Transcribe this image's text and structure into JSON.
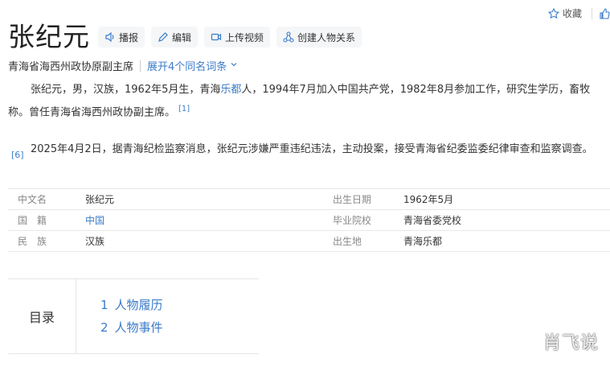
{
  "top_actions": {
    "favorite_label": "收藏"
  },
  "title": "张纪元",
  "toolbar": {
    "play_label": "播报",
    "edit_label": "编辑",
    "upload_video_label": "上传视频",
    "create_relation_label": "创建人物关系"
  },
  "subtitle": "青海省海西州政协原副主席",
  "expand_link": "展开4个同名词条",
  "summary": {
    "p1_a": "张纪元，男，汉族，1962年5月生，青海",
    "p1_link": "乐都",
    "p1_b": "人，1994年7月加入中国共产党，1982年8月参加工作，研究生学历，畜牧",
    "p1_c": "称。曾任青海省海西州政协副主席。",
    "ref1": "[1]",
    "p2": "2025年4月2日，据青海纪检监察消息，张纪元涉嫌严重违纪违法，主动投案，接受青海省纪委监委纪律审查和监察调查。",
    "ref6": "[6]"
  },
  "info": [
    {
      "k1": "中文名",
      "v1": "张纪元",
      "k2": "出生日期",
      "v2": "1962年5月"
    },
    {
      "k1": "国　籍",
      "v1": "中国",
      "k2": "毕业院校",
      "v2": "青海省委党校"
    },
    {
      "k1": "民　族",
      "v1": "汉族",
      "k2": "出生地",
      "v2": "青海乐都"
    }
  ],
  "toc": {
    "label": "目录",
    "items": [
      {
        "num": "1",
        "text": "人物履历"
      },
      {
        "num": "2",
        "text": "人物事件"
      }
    ]
  },
  "watermark": "肖飞说",
  "colors": {
    "link": "#3b7cc8",
    "button_bg": "#f5f6f8"
  }
}
